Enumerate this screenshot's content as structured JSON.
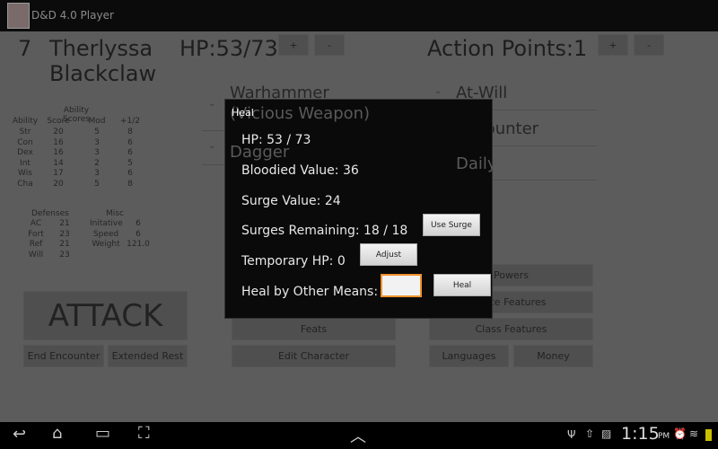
{
  "app": {
    "title": "D&D 4.0 Player"
  },
  "header": {
    "level": "7",
    "name_line1": "Therlyssa",
    "name_line2": "Blackclaw",
    "hp": "HP:53/73",
    "action_points": "Action Points:1",
    "plus": "+",
    "minus": "-"
  },
  "abilities": {
    "title": "Ability Scores",
    "headers": [
      "Ability",
      "Score",
      "Mod",
      "+1/2"
    ],
    "rows": [
      [
        "Str",
        "20",
        "5",
        "8"
      ],
      [
        "Con",
        "16",
        "3",
        "6"
      ],
      [
        "Dex",
        "16",
        "3",
        "6"
      ],
      [
        "Int",
        "14",
        "2",
        "5"
      ],
      [
        "Wis",
        "17",
        "3",
        "6"
      ],
      [
        "Cha",
        "20",
        "5",
        "8"
      ]
    ]
  },
  "defenses": {
    "title": "Defenses",
    "rows": [
      [
        "AC",
        "21"
      ],
      [
        "Fort",
        "23"
      ],
      [
        "Ref",
        "21"
      ],
      [
        "Will",
        "23"
      ]
    ]
  },
  "misc": {
    "title": "Misc",
    "rows": [
      [
        "Initative",
        "6"
      ],
      [
        "Speed",
        "6"
      ],
      [
        "Weight",
        "121.0"
      ]
    ]
  },
  "weapons": [
    "Warhammer",
    "(Vicious Weapon)",
    "Dagger"
  ],
  "powers": [
    "At-Will",
    "Encounter",
    "Daily"
  ],
  "buttons": {
    "attack": "ATTACK",
    "end_encounter": "End Encounter",
    "extended_rest": "Extended Rest",
    "feats": "Feats",
    "edit_character": "Edit Character",
    "powers": "Powers",
    "race_features": "Race Features",
    "class_features": "Class Features",
    "languages": "Languages",
    "money": "Money"
  },
  "dialog": {
    "title": "Heal",
    "hp": "HP:  53  /  73",
    "bloodied": "Bloodied Value:  36",
    "surge_value": "Surge Value:  24",
    "surges_remaining": "Surges Remaining:  18  /  18",
    "temp_hp": "Temporary HP:  0",
    "heal_other": "Heal by Other Means:",
    "use_surge": "Use Surge",
    "adjust": "Adjust",
    "heal": "Heal",
    "heal_input": ""
  },
  "status": {
    "time": "1:15",
    "ampm": "PM"
  }
}
